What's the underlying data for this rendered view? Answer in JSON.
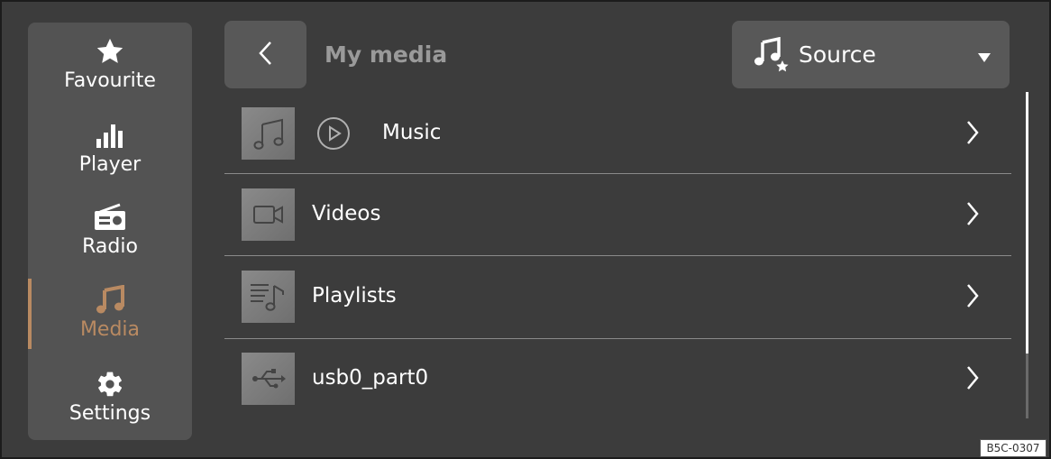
{
  "sidebar": {
    "items": [
      {
        "label": "Favourite",
        "icon": "star-icon"
      },
      {
        "label": "Player",
        "icon": "bar-chart-icon"
      },
      {
        "label": "Radio",
        "icon": "radio-icon"
      },
      {
        "label": "Media",
        "icon": "music-note-icon",
        "active": true
      },
      {
        "label": "Settings",
        "icon": "gear-icon"
      }
    ]
  },
  "header": {
    "title": "My media",
    "back_icon": "chevron-left-icon",
    "source": {
      "label": "Source",
      "icon": "music-note-star-icon",
      "caret": "caret-down-icon"
    }
  },
  "list": {
    "items": [
      {
        "label": "Music",
        "icon": "music-note-icon",
        "has_play": true
      },
      {
        "label": "Videos",
        "icon": "video-camera-icon"
      },
      {
        "label": "Playlists",
        "icon": "playlist-icon"
      },
      {
        "label": "usb0_part0",
        "icon": "usb-icon"
      }
    ]
  },
  "figure_code": "B5C-0307",
  "colors": {
    "background": "#3c3c3c",
    "panel": "#535353",
    "button": "#585858",
    "accent": "#b98a62",
    "title": "#9a9a9a"
  }
}
